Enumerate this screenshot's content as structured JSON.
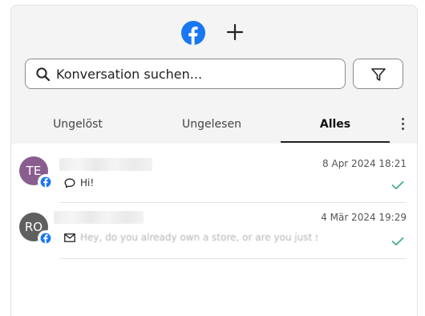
{
  "header": {
    "logo_icon": "facebook-icon",
    "new_conversation_icon": "plus-icon"
  },
  "search": {
    "placeholder": "Konversation suchen..."
  },
  "filter": {
    "icon": "filter-icon"
  },
  "tabs": [
    {
      "label": "Ungelöst",
      "active": false
    },
    {
      "label": "Ungelesen",
      "active": false
    },
    {
      "label": "Alles",
      "active": true
    }
  ],
  "conversations": [
    {
      "initials": "TE",
      "channel": "facebook",
      "timestamp": "8 Apr 2024 18:21",
      "preview_icon": "chat-bubble-icon",
      "preview": "Hi!",
      "status": "check-icon"
    },
    {
      "initials": "RO",
      "channel": "facebook",
      "timestamp": "4 Mär 2024 19:29",
      "preview_icon": "envelope-icon",
      "preview": "Hey, do you already own a store, or are you just starting...",
      "status": "check-icon"
    }
  ],
  "colors": {
    "facebook_blue": "#1877f2",
    "avatar_te": "#8a5d8f",
    "avatar_ro": "#5f5f5f",
    "check_green": "#4caf8e"
  }
}
